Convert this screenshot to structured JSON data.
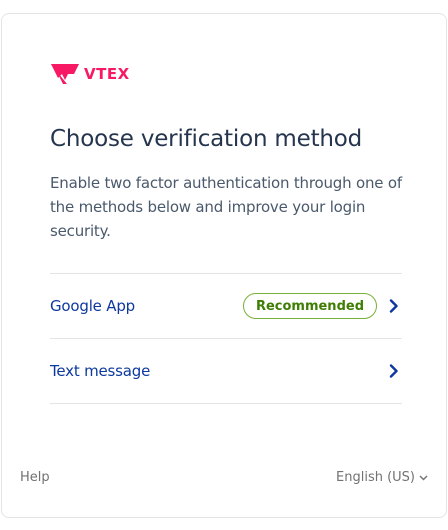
{
  "brand": {
    "logo_text": "VTEX",
    "color": "#f71963"
  },
  "header": {
    "title": "Choose verification method",
    "description": "Enable two factor authentication through one of the methods below and improve your login security."
  },
  "methods": [
    {
      "label": "Google App",
      "badge": "Recommended",
      "icon": "chevron-right-icon"
    },
    {
      "label": "Text message",
      "icon": "chevron-right-icon"
    }
  ],
  "footer": {
    "help": "Help",
    "language": "English (US)",
    "language_icon": "chevron-down-icon"
  },
  "colors": {
    "link": "#0c389f",
    "badge_border": "#79b03a",
    "badge_text": "#3f7e04",
    "title": "#25354d"
  }
}
